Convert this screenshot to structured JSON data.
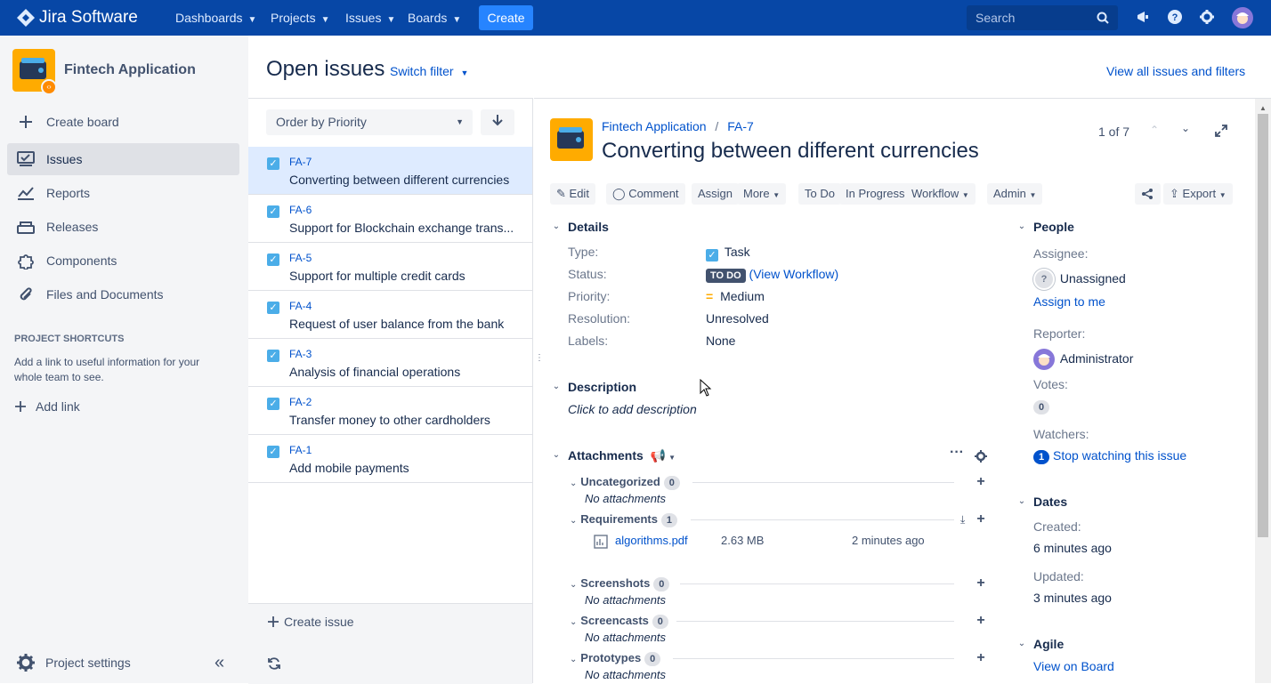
{
  "topbar": {
    "logo": "Jira Software",
    "nav": [
      "Dashboards",
      "Projects",
      "Issues",
      "Boards"
    ],
    "create": "Create",
    "search_placeholder": "Search"
  },
  "sidebar": {
    "project_name": "Fintech Application",
    "items": [
      {
        "label": "Create board",
        "icon": "plus-icon"
      },
      {
        "label": "Issues",
        "icon": "issues-icon"
      },
      {
        "label": "Reports",
        "icon": "reports-icon"
      },
      {
        "label": "Releases",
        "icon": "releases-icon"
      },
      {
        "label": "Components",
        "icon": "components-icon"
      },
      {
        "label": "Files and Documents",
        "icon": "attachment-icon"
      }
    ],
    "shortcuts_heading": "PROJECT SHORTCUTS",
    "shortcuts_text": "Add a link to useful information for your whole team to see.",
    "add_link": "Add link",
    "settings": "Project settings"
  },
  "header": {
    "title": "Open issues",
    "switch_filter": "Switch filter",
    "view_all": "View all issues and filters"
  },
  "list": {
    "order": "Order by Priority",
    "issues": [
      {
        "key": "FA-7",
        "summary": "Converting between different currencies"
      },
      {
        "key": "FA-6",
        "summary": "Support for Blockchain exchange trans..."
      },
      {
        "key": "FA-5",
        "summary": "Support for multiple credit cards"
      },
      {
        "key": "FA-4",
        "summary": "Request of user balance from the bank"
      },
      {
        "key": "FA-3",
        "summary": "Analysis of financial operations"
      },
      {
        "key": "FA-2",
        "summary": "Transfer money to other cardholders"
      },
      {
        "key": "FA-1",
        "summary": "Add mobile payments"
      }
    ],
    "create_issue": "Create issue"
  },
  "issue": {
    "project": "Fintech Application",
    "key": "FA-7",
    "title": "Converting between different currencies",
    "pager": "1 of 7",
    "actions": {
      "edit": "Edit",
      "comment": "Comment",
      "assign": "Assign",
      "more": "More",
      "todo": "To Do",
      "in_progress": "In Progress",
      "workflow": "Workflow",
      "admin": "Admin",
      "export": "Export"
    },
    "details": {
      "heading": "Details",
      "type_label": "Type:",
      "type": "Task",
      "status_label": "Status:",
      "status": "TO DO",
      "view_workflow": "(View Workflow)",
      "priority_label": "Priority:",
      "priority": "Medium",
      "resolution_label": "Resolution:",
      "resolution": "Unresolved",
      "labels_label": "Labels:",
      "labels": "None"
    },
    "description": {
      "heading": "Description",
      "placeholder": "Click to add description"
    },
    "attachments": {
      "heading": "Attachments",
      "no_attachments": "No attachments",
      "groups": [
        {
          "name": "Uncategorized",
          "count": "0"
        },
        {
          "name": "Requirements",
          "count": "1"
        },
        {
          "name": "Screenshots",
          "count": "0"
        },
        {
          "name": "Screencasts",
          "count": "0"
        },
        {
          "name": "Prototypes",
          "count": "0"
        }
      ],
      "file": {
        "name": "algorithms.pdf",
        "size": "2.63 MB",
        "time": "2 minutes ago"
      }
    },
    "people": {
      "heading": "People",
      "assignee_label": "Assignee:",
      "assignee": "Unassigned",
      "assign_to_me": "Assign to me",
      "reporter_label": "Reporter:",
      "reporter": "Administrator",
      "votes_label": "Votes:",
      "votes": "0",
      "watchers_label": "Watchers:",
      "watchers_count": "1",
      "stop_watching": "Stop watching this issue"
    },
    "dates": {
      "heading": "Dates",
      "created_label": "Created:",
      "created": "6 minutes ago",
      "updated_label": "Updated:",
      "updated": "3 minutes ago"
    },
    "agile": {
      "heading": "Agile",
      "view_on_board": "View on Board"
    }
  },
  "colors": {
    "topbar": "#0747a6",
    "accent": "#0052cc",
    "create": "#2684ff"
  }
}
